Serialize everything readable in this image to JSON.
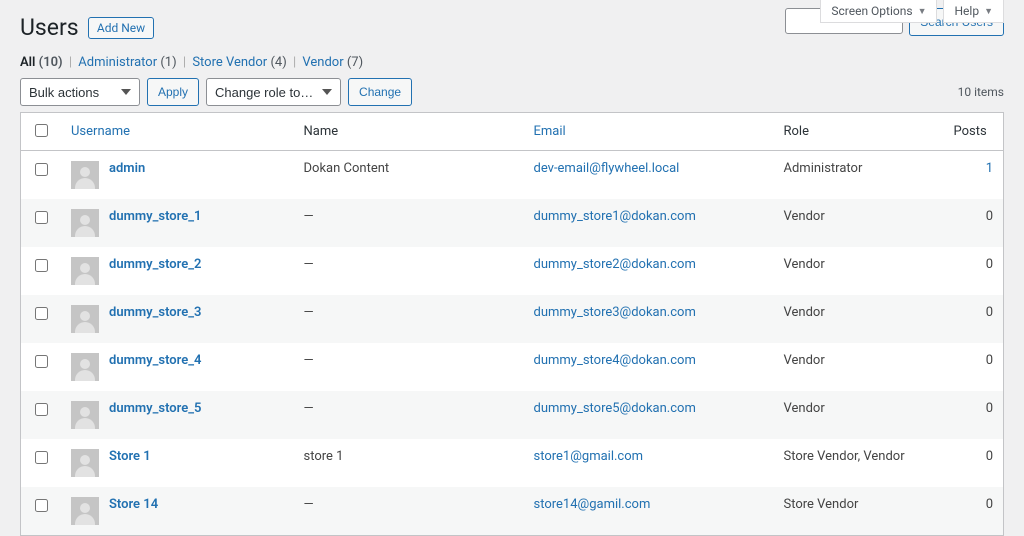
{
  "top_tabs": {
    "screen_options": "Screen Options",
    "help": "Help"
  },
  "header": {
    "title": "Users",
    "add_new": "Add New"
  },
  "search": {
    "placeholder": "",
    "button": "Search Users"
  },
  "filters": {
    "all_label": "All",
    "all_count": "(10)",
    "admin_label": "Administrator",
    "admin_count": "(1)",
    "store_vendor_label": "Store Vendor",
    "store_vendor_count": "(4)",
    "vendor_label": "Vendor",
    "vendor_count": "(7)"
  },
  "actions": {
    "bulk_placeholder": "Bulk actions",
    "apply": "Apply",
    "role_placeholder": "Change role to…",
    "change": "Change",
    "items_count": "10 items"
  },
  "columns": {
    "username": "Username",
    "name": "Name",
    "email": "Email",
    "role": "Role",
    "posts": "Posts"
  },
  "rows": [
    {
      "username": "admin",
      "name": "Dokan Content",
      "email": "dev-email@flywheel.local",
      "role": "Administrator",
      "posts": "1",
      "posts_link": true
    },
    {
      "username": "dummy_store_1",
      "name": "—",
      "email": "dummy_store1@dokan.com",
      "role": "Vendor",
      "posts": "0"
    },
    {
      "username": "dummy_store_2",
      "name": "—",
      "email": "dummy_store2@dokan.com",
      "role": "Vendor",
      "posts": "0"
    },
    {
      "username": "dummy_store_3",
      "name": "—",
      "email": "dummy_store3@dokan.com",
      "role": "Vendor",
      "posts": "0"
    },
    {
      "username": "dummy_store_4",
      "name": "—",
      "email": "dummy_store4@dokan.com",
      "role": "Vendor",
      "posts": "0"
    },
    {
      "username": "dummy_store_5",
      "name": "—",
      "email": "dummy_store5@dokan.com",
      "role": "Vendor",
      "posts": "0"
    },
    {
      "username": "Store 1",
      "name": "store 1",
      "email": "store1@gmail.com",
      "role": "Store Vendor, Vendor",
      "posts": "0"
    },
    {
      "username": "Store 14",
      "name": "—",
      "email": "store14@gamil.com",
      "role": "Store Vendor",
      "posts": "0"
    }
  ]
}
